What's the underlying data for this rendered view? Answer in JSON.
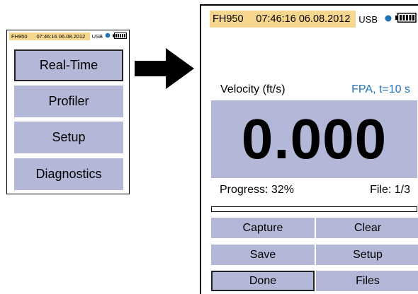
{
  "small_screen": {
    "status": {
      "device": "FH950",
      "datetime": "07:46:16  06.08.2012",
      "usb": "USB"
    },
    "menu": [
      {
        "label": "Real-Time",
        "selected": true
      },
      {
        "label": "Profiler",
        "selected": false
      },
      {
        "label": "Setup",
        "selected": false
      },
      {
        "label": "Diagnostics",
        "selected": false
      }
    ]
  },
  "large_screen": {
    "status": {
      "device": "FH950",
      "datetime": "07:46:16  06.08.2012",
      "usb": "USB"
    },
    "measurement_label": "Velocity (ft/s)",
    "mode_label": "FPA, t=10 s",
    "value": "0.000",
    "progress_label": "Progress: 32%",
    "progress_fraction": 0.32,
    "file_label": "File: 1/3",
    "buttons": [
      {
        "label": "Capture"
      },
      {
        "label": "Clear"
      },
      {
        "label": "Save"
      },
      {
        "label": "Setup"
      },
      {
        "label": "Done",
        "selected": true
      },
      {
        "label": "Files"
      }
    ]
  },
  "colors": {
    "status_bar": "#f7d68e",
    "button_fill": "#b4b8d8",
    "accent_blue": "#1f72b8",
    "connection_dot": "#1f72b8"
  },
  "icons": [
    "connection-dot-icon",
    "battery-icon",
    "right-arrow-icon"
  ]
}
